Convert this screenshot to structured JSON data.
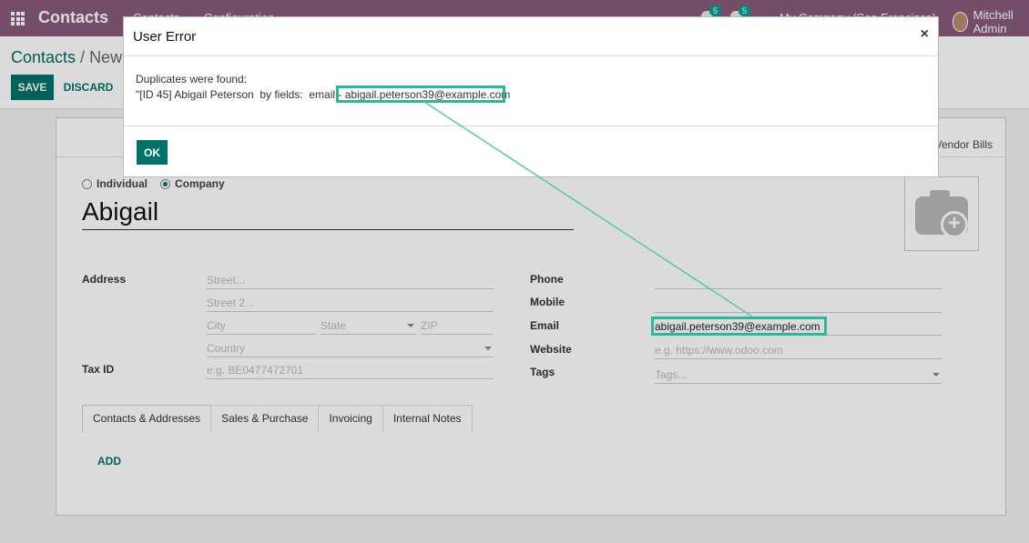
{
  "navbar": {
    "app_name": "Contacts",
    "menu_contacts": "Contacts",
    "menu_config": "Configuration",
    "messages_count": "5",
    "activities_count": "5",
    "company_switcher": "My Company (San Francisco)",
    "user_name": "Mitchell Admin"
  },
  "breadcrumb": {
    "root": "Contacts",
    "separator": " / ",
    "current": "New"
  },
  "toolbar": {
    "save_label": "SAVE",
    "discard_label": "DISCARD"
  },
  "smart_buttons": {
    "vendor_bills": "Vendor Bills"
  },
  "form": {
    "type_individual": "Individual",
    "type_company": "Company",
    "name": "Abigail",
    "address_label": "Address",
    "street_placeholder": "Street...",
    "street2_placeholder": "Street 2...",
    "city_placeholder": "City",
    "state_placeholder": "State",
    "zip_placeholder": "ZIP",
    "country_placeholder": "Country",
    "taxid_label": "Tax ID",
    "taxid_placeholder": "e.g. BE0477472701",
    "phone_label": "Phone",
    "mobile_label": "Mobile",
    "email_label": "Email",
    "email_value": "abigail.peterson39@example.com",
    "website_label": "Website",
    "website_placeholder": "e.g. https://www.odoo.com",
    "tags_label": "Tags",
    "tags_placeholder": "Tags..."
  },
  "tabs": [
    "Contacts & Addresses",
    "Sales & Purchase",
    "Invoicing",
    "Internal Notes"
  ],
  "add_label": "ADD",
  "modal": {
    "title": "User Error",
    "close": "×",
    "line1": "Duplicates were found:",
    "line2_prefix": "\"[ID 45] Abigail Peterson  by fields:  email - ",
    "line2_email": "abigail.peterson39@example.com",
    "ok_label": "OK"
  },
  "colors": {
    "navbar": "#875a7b",
    "primary": "#00716b",
    "highlight": "#2fb598"
  }
}
